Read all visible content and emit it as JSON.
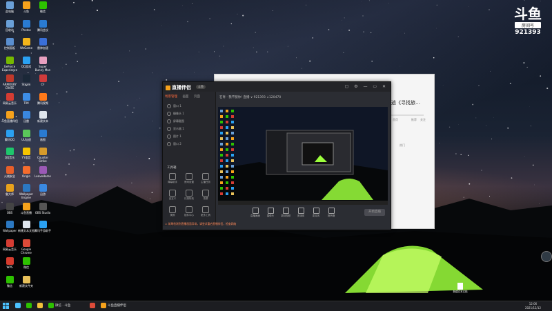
{
  "desktop": {
    "icons": [
      {
        "label": "此电脑",
        "color": "#6aa0d8",
        "col": 0,
        "row": 0
      },
      {
        "label": "回收站",
        "color": "#6aa0d8",
        "col": 0,
        "row": 1
      },
      {
        "label": "控制面板",
        "color": "#5a8fd0",
        "col": 0,
        "row": 2
      },
      {
        "label": "GeForce Experience",
        "color": "#76b900",
        "col": 0,
        "row": 3
      },
      {
        "label": "ARMOURY CRATE",
        "color": "#c0392b",
        "col": 0,
        "row": 4
      },
      {
        "label": "网易云音乐",
        "color": "#d43c33",
        "col": 0,
        "row": 5
      },
      {
        "label": "斗鱼直播伴侣",
        "color": "#f6a21c",
        "col": 0,
        "row": 6
      },
      {
        "label": "腾讯QQ",
        "color": "#2aa1f2",
        "col": 0,
        "row": 7
      },
      {
        "label": "QQ音乐",
        "color": "#1ec66c",
        "col": 0,
        "row": 8
      },
      {
        "label": "火绒安全",
        "color": "#e85f2a",
        "col": 0,
        "row": 9
      },
      {
        "label": "鲁大师",
        "color": "#e8a11c",
        "col": 0,
        "row": 10
      },
      {
        "label": "OBS",
        "color": "#444",
        "col": 0,
        "row": 11
      },
      {
        "label": "Wallpaper",
        "color": "#2b78c2",
        "col": 0,
        "row": 12
      },
      {
        "label": "网易云音乐",
        "color": "#d43c33",
        "col": 0,
        "row": 13
      },
      {
        "label": "WPS",
        "color": "#d63c2e",
        "col": 0,
        "row": 14
      },
      {
        "label": "微信",
        "color": "#2dc100",
        "col": 0,
        "row": 15
      },
      {
        "label": "斗鱼",
        "color": "#f6a21c",
        "col": 1,
        "row": 0
      },
      {
        "label": "Photos",
        "color": "#2a7bd1",
        "col": 1,
        "row": 1
      },
      {
        "label": "WeGame",
        "color": "#f3b51a",
        "col": 1,
        "row": 2
      },
      {
        "label": "QQ游戏",
        "color": "#2aa1f2",
        "col": 1,
        "row": 3
      },
      {
        "label": "Steam",
        "color": "#1b2838",
        "col": 1,
        "row": 4
      },
      {
        "label": "TIM",
        "color": "#3d8de6",
        "col": 1,
        "row": 5
      },
      {
        "label": "迅雷",
        "color": "#3a88e0",
        "col": 1,
        "row": 6
      },
      {
        "label": "UU加速",
        "color": "#5ac85a",
        "col": 1,
        "row": 7
      },
      {
        "label": "YY语音",
        "color": "#f5c400",
        "col": 1,
        "row": 8
      },
      {
        "label": "Origin",
        "color": "#f56c2d",
        "col": 1,
        "row": 9
      },
      {
        "label": "Wallpaper Engine",
        "color": "#2b78c2",
        "col": 1,
        "row": 10
      },
      {
        "label": "斗鱼直播",
        "color": "#f6a21c",
        "col": 1,
        "row": 11
      },
      {
        "label": "新建文本文档",
        "color": "#dfe6ee",
        "col": 1,
        "row": 12
      },
      {
        "label": "Google Chrome",
        "color": "#dd4b39",
        "col": 1,
        "row": 13
      },
      {
        "label": "微信",
        "color": "#2dc100",
        "col": 1,
        "row": 14
      },
      {
        "label": "新建文件夹",
        "color": "#e8c15a",
        "col": 1,
        "row": 15
      },
      {
        "label": "微信",
        "color": "#2dc100",
        "col": 2,
        "row": 0
      },
      {
        "label": "腾讯会议",
        "color": "#2a7bd1",
        "col": 2,
        "row": 1
      },
      {
        "label": "雷神加速",
        "color": "#3a6fd8",
        "col": 2,
        "row": 2
      },
      {
        "label": "Super Bunny Man",
        "color": "#e8a0c0",
        "col": 2,
        "row": 3
      },
      {
        "label": "CF",
        "color": "#d03b3b",
        "col": 2,
        "row": 4
      },
      {
        "label": "腾讯视频",
        "color": "#ff7a1a",
        "col": 2,
        "row": 5
      },
      {
        "label": "新建文本",
        "color": "#dfe6ee",
        "col": 2,
        "row": 6
      },
      {
        "label": "画图",
        "color": "#2a7bd1",
        "col": 2,
        "row": 7
      },
      {
        "label": "Counter Strike",
        "color": "#d79b2b",
        "col": 2,
        "row": 8
      },
      {
        "label": "LeaveHome",
        "color": "#9b59b6",
        "col": 2,
        "row": 9
      },
      {
        "label": "迅游",
        "color": "#3a88e0",
        "col": 2,
        "row": 10
      },
      {
        "label": "OBS Studio",
        "color": "#555",
        "col": 2,
        "row": 11
      },
      {
        "label": "腾讯手游助手",
        "color": "#2aa1f2",
        "col": 2,
        "row": 12
      }
    ],
    "file": {
      "label": "新建文本文档"
    }
  },
  "douyu_logo": {
    "mark": "斗鱼",
    "subtitle": "房间号",
    "room_number": "921393"
  },
  "bg_window": {
    "title": "逍《寻找旅…",
    "labels": [
      "首页",
      "推荐",
      "关注",
      "热门"
    ]
  },
  "app": {
    "brand": "直播伴侣",
    "version": "斗鱼",
    "window_controls": "▢ ⚙ — ▭ ✕",
    "tabs": [
      "场景管理",
      "画面",
      "页面"
    ],
    "scenes": [
      "窗口 1",
      "摄像头 1",
      "屏幕截图",
      "显示器 1",
      "图片 1",
      "窗口 2"
    ],
    "tools_title": "工具箱",
    "tools": [
      "弹幕助手",
      "房间设置",
      "主播任务",
      "自定义",
      "礼物特效",
      "录屏",
      "美颜",
      "插件中心",
      "更多工具"
    ],
    "topbar_text": "石青 · 我不服你! 直播 ∨  921393  ↓120470",
    "bottom_tools": [
      "直播画面",
      "摄像头",
      "录制视频",
      "多媒体",
      "麦克风",
      "扬声器"
    ],
    "start_label": "开始直播",
    "status_text": "⚠ 如果检测到直播画面异常，请尝试重启直播伴侣，检查网络"
  },
  "taskbar": {
    "items": [
      {
        "label": "",
        "color": "#4cc2ff"
      },
      {
        "label": "",
        "color": "#2dc100"
      },
      {
        "label": "",
        "color": "#f3c23a"
      },
      {
        "label": "微信 · 斗鱼",
        "color": "#2dc100"
      },
      {
        "label": "",
        "color": "#dd4b39"
      },
      {
        "label": "斗鱼直播伴侣",
        "color": "#f6a21c"
      }
    ],
    "time": "12:06",
    "date": "2021/12/12"
  },
  "colors": {
    "accent": "#ff6a3d",
    "tent": "#9cff3c"
  }
}
